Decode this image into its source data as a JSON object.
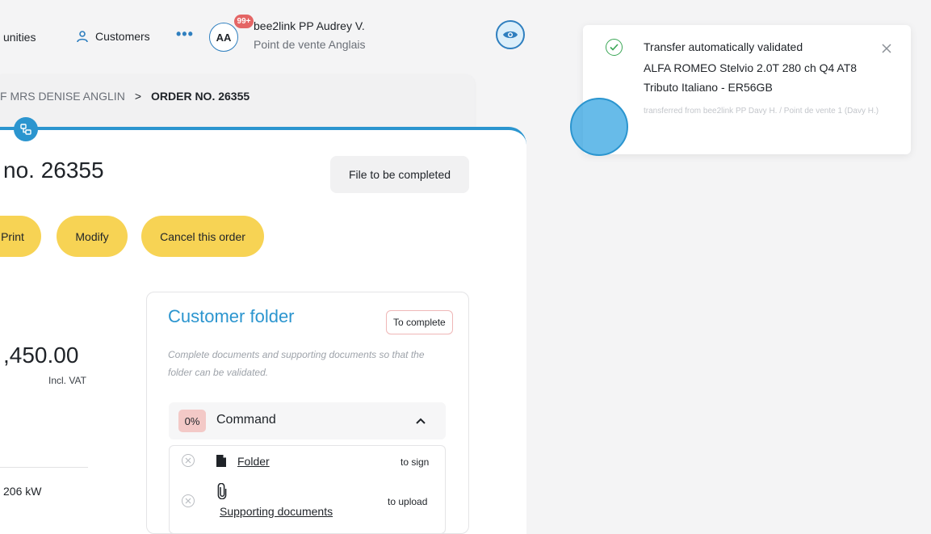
{
  "nav": {
    "opportunities_partial": "unities",
    "customers_label": "Customers",
    "more_label": "•••"
  },
  "user": {
    "initials": "AA",
    "notif_count": "99+",
    "name": "bee2link PP Audrey V.",
    "store": "Point de vente Anglais"
  },
  "breadcrumb": {
    "prev": "F MRS DENISE ANGLIN",
    "separator": ">",
    "current": "ORDER NO. 26355"
  },
  "order": {
    "title_partial": "no. 26355",
    "status": "File to be completed",
    "price_partial": ",450.00",
    "price_note": "Incl. VAT",
    "power_partial": "206 kW"
  },
  "actions": {
    "print_partial": "Print",
    "modify": "Modify",
    "cancel": "Cancel this order"
  },
  "folder": {
    "title": "Customer folder",
    "badge": "To complete",
    "description": "Complete documents and supporting documents so that the folder can be validated.",
    "section": {
      "percent": "0%",
      "label": "Command"
    },
    "items": [
      {
        "label": "Folder",
        "action": "to sign"
      },
      {
        "label": "Supporting documents",
        "action": "to upload"
      }
    ]
  },
  "toast": {
    "title": "Transfer automatically validated",
    "vehicle": "ALFA ROMEO Stelvio 2.0T 280 ch Q4 AT8",
    "trim": "Tributo Italiano - ER56GB",
    "meta": "transferred from bee2link PP Davy H. / Point de vente 1 (Davy H.)"
  },
  "colors": {
    "accent_blue": "#2b95cf",
    "button_yellow": "#f7d354",
    "success_green": "#3aa655",
    "danger_soft": "#f3c9c7"
  }
}
